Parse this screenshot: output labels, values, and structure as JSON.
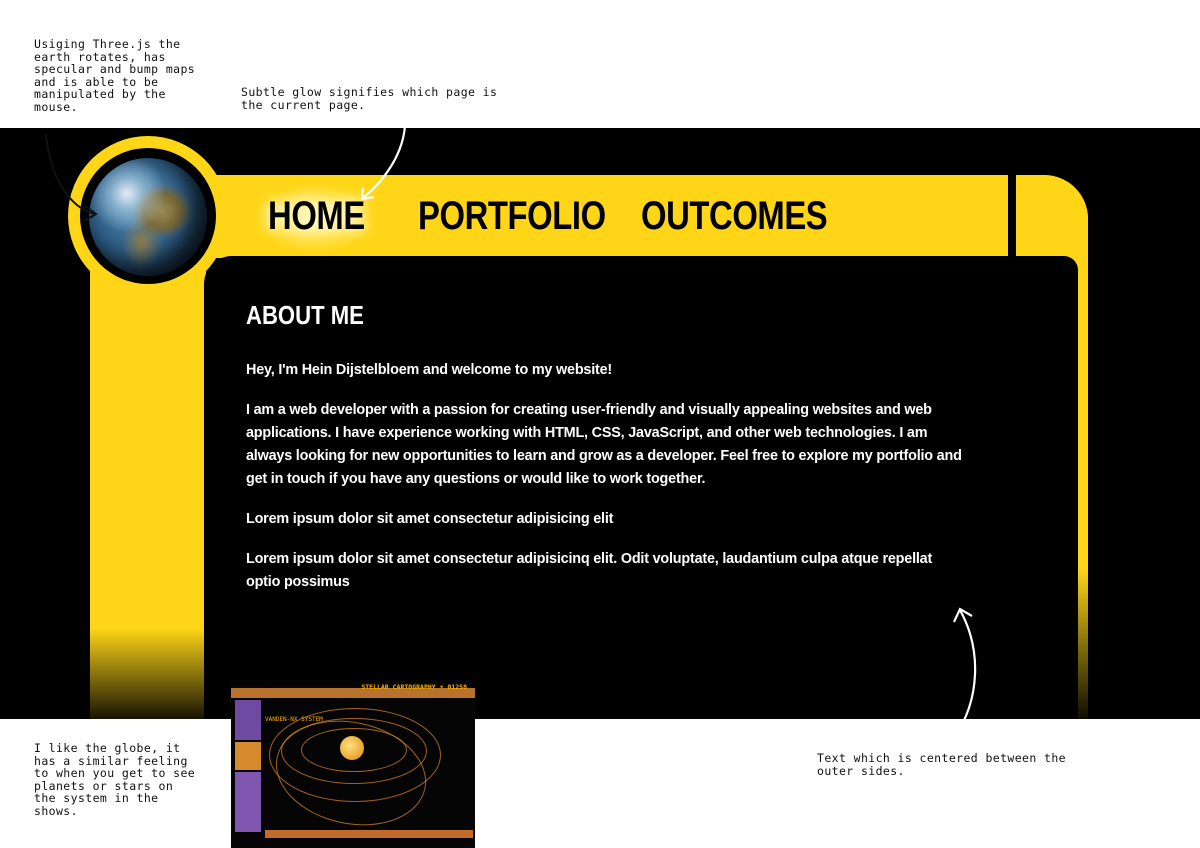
{
  "annotations": {
    "globe": "Usiging Three.js the earth rotates, has specular and bump maps and is able to be manipulated by the mouse.",
    "glow": "Subtle glow signifies which page is the current page.",
    "like_globe": "I like the globe, it has a similar feeling to when you get to see planets or stars on the system in the shows.",
    "centered": "Text which is centered between the outer sides."
  },
  "nav": {
    "items": [
      {
        "label": "HOME",
        "current": true
      },
      {
        "label": "PORTFOLIO",
        "current": false
      },
      {
        "label": "OUTCOMES",
        "current": false
      }
    ]
  },
  "content": {
    "heading": "ABOUT ME",
    "paragraphs": [
      "Hey, I'm Hein Dijstelbloem and welcome to my website!",
      "I am a web developer with a passion for creating user-friendly and visually appealing websites and web applications. I have experience working with HTML, CSS, JavaScript, and other web technologies. I am always looking for new opportunities to learn and grow as a developer. Feel free to explore my portfolio and get in touch if you have any questions or would like to work together.",
      "Lorem ipsum dolor sit amet consectetur adipisicing elit",
      "Lorem ipsum dolor sit amet consectetur adipisicinq elit. Odit voluptate, laudantium culpa atque repellat optio possimus"
    ]
  },
  "reference_image": {
    "title": "STELLAR CARTOGRAPHY • 01258",
    "system_label": "VANDEN-NX SYSTEM"
  },
  "colors": {
    "lcars_yellow": "#ffd617",
    "background": "#000000",
    "text": "#ffffff"
  }
}
